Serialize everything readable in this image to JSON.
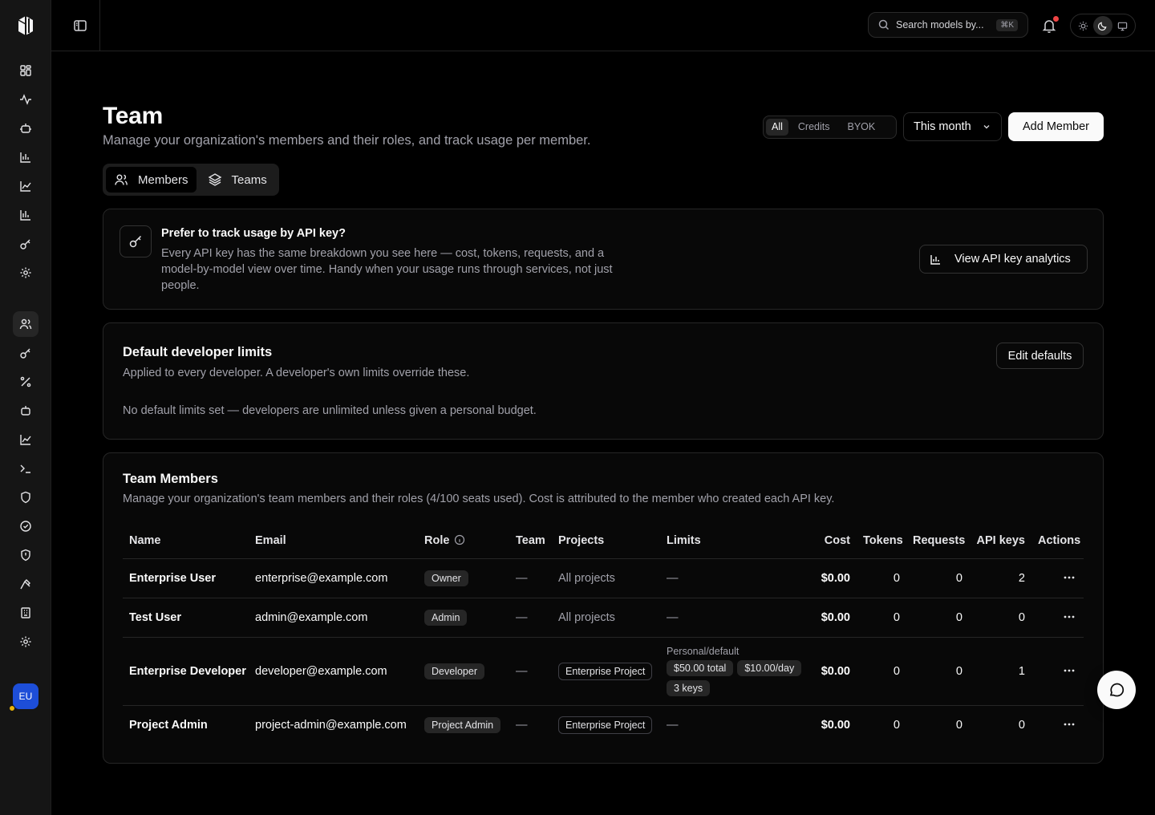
{
  "app": {
    "avatar_initials": "EU"
  },
  "topbar": {
    "search_placeholder": "Search models by...",
    "search_shortcut": "⌘K"
  },
  "sidebar": {
    "icons": [
      "dashboard-icon",
      "activity-icon",
      "bot-icon",
      "bar-chart-icon",
      "line-chart-icon",
      "chart-icon",
      "key-icon",
      "settings-icon",
      "users-icon",
      "key-icon",
      "percent-icon",
      "bot-icon",
      "trend-icon",
      "terminal-icon",
      "shield-icon",
      "check-circle-icon",
      "shield-alert-icon",
      "hammer-icon",
      "building-icon",
      "gear-icon"
    ],
    "active": "users-icon"
  },
  "header": {
    "title": "Team",
    "subtitle": "Manage your organization's members and their roles, and track usage per member.",
    "filter_segments": [
      "All",
      "Credits",
      "BYOK"
    ],
    "active_segment": "All",
    "period": "This month",
    "add_button": "Add Member",
    "tabs": [
      "Members",
      "Teams"
    ],
    "active_tab": "Members"
  },
  "api_card": {
    "title": "Prefer to track usage by API key?",
    "text": "Every API key has the same breakdown you see here — cost, tokens, requests, and a model-by-model view over time. Handy when your usage runs through services, not just people.",
    "button": "View API key analytics"
  },
  "limits_card": {
    "title": "Default developer limits",
    "subtitle": "Applied to every developer. A developer's own limits override these.",
    "empty": "No default limits set — developers are unlimited unless given a personal budget.",
    "button": "Edit defaults"
  },
  "members_card": {
    "title": "Team Members",
    "subtitle": "Manage your organization's team members and their roles (4/100 seats used). Cost is attributed to the member who created each API key.",
    "columns": [
      "Name",
      "Email",
      "Role",
      "Team",
      "Projects",
      "Limits",
      "Cost",
      "Tokens",
      "Requests",
      "API keys",
      "Actions"
    ],
    "rows": [
      {
        "name": "Enterprise User",
        "email": "enterprise@example.com",
        "role": "Owner",
        "team": "—",
        "projects": "All projects",
        "limits": "—",
        "cost": "$0.00",
        "tokens": "0",
        "requests": "0",
        "api_keys": "2"
      },
      {
        "name": "Test User",
        "email": "admin@example.com",
        "role": "Admin",
        "team": "—",
        "projects": "All projects",
        "limits": "—",
        "cost": "$0.00",
        "tokens": "0",
        "requests": "0",
        "api_keys": "0"
      },
      {
        "name": "Enterprise Developer",
        "email": "developer@example.com",
        "role": "Developer",
        "team": "—",
        "projects": "Enterprise Project",
        "limits_label": "Personal/default",
        "limits_chips": [
          "$50.00 total",
          "$10.00/day",
          "3 keys"
        ],
        "cost": "$0.00",
        "tokens": "0",
        "requests": "0",
        "api_keys": "1"
      },
      {
        "name": "Project Admin",
        "email": "project-admin@example.com",
        "role": "Project Admin",
        "team": "—",
        "projects": "Enterprise Project",
        "limits": "—",
        "cost": "$0.00",
        "tokens": "0",
        "requests": "0",
        "api_keys": "0"
      }
    ]
  }
}
